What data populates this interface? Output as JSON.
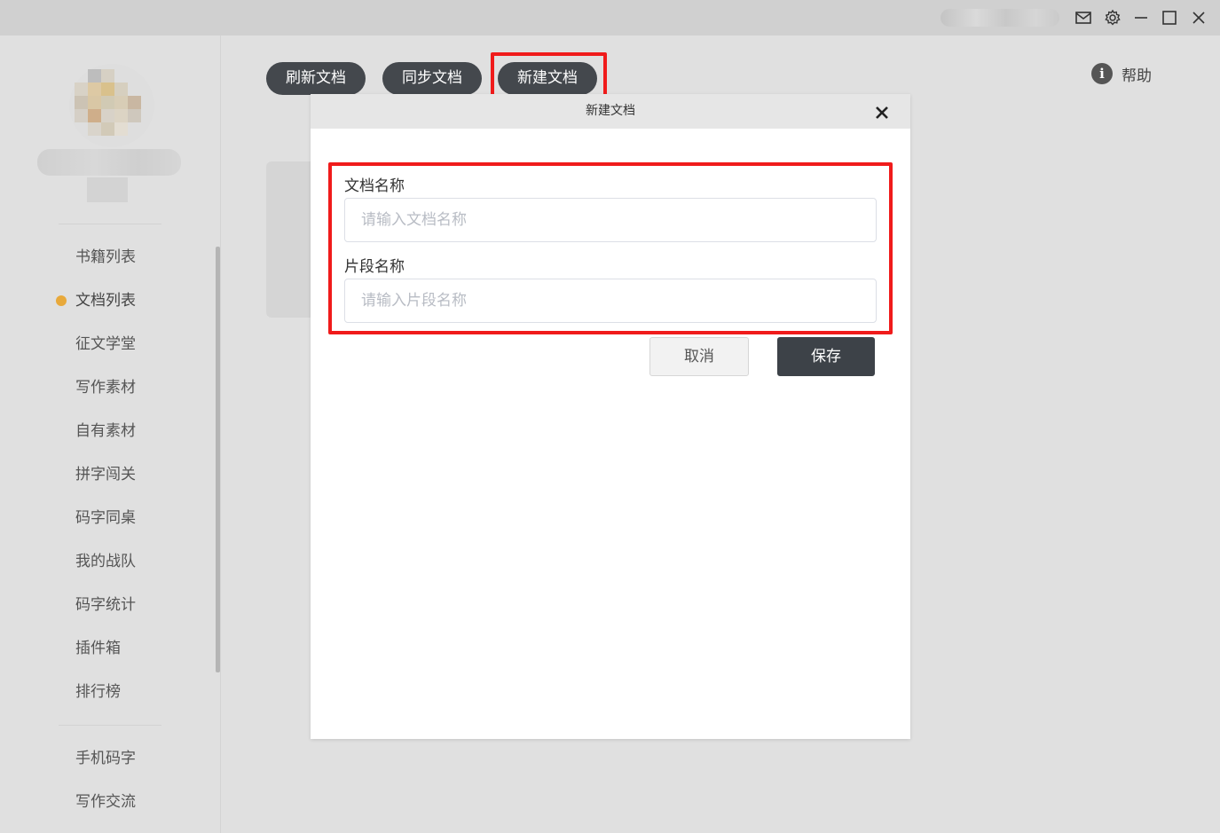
{
  "titlebar": {
    "icons": [
      "mail-icon",
      "gear-icon",
      "minimize-icon",
      "maximize-icon",
      "close-icon"
    ]
  },
  "sidebar": {
    "nav_items": [
      {
        "label": "书籍列表",
        "active": false
      },
      {
        "label": "文档列表",
        "active": true
      },
      {
        "label": "征文学堂",
        "active": false
      },
      {
        "label": "写作素材",
        "active": false
      },
      {
        "label": "自有素材",
        "active": false
      },
      {
        "label": "拼字闯关",
        "active": false
      },
      {
        "label": "码字同桌",
        "active": false
      },
      {
        "label": "我的战队",
        "active": false
      },
      {
        "label": "码字统计",
        "active": false
      },
      {
        "label": "插件箱",
        "active": false
      },
      {
        "label": "排行榜",
        "active": false
      }
    ],
    "bottom_items": [
      {
        "label": "手机码字"
      },
      {
        "label": "写作交流"
      }
    ],
    "active_dot_color": "#e8a93b"
  },
  "toolbar": {
    "refresh_label": "刷新文档",
    "sync_label": "同步文档",
    "new_label": "新建文档",
    "help_label": "帮助"
  },
  "dialog": {
    "title": "新建文档",
    "doc_name_label": "文档名称",
    "doc_name_placeholder": "请输入文档名称",
    "doc_name_value": "",
    "section_name_label": "片段名称",
    "section_name_placeholder": "请输入片段名称",
    "section_name_value": "",
    "cancel_label": "取消",
    "save_label": "保存"
  },
  "colors": {
    "highlight": "#f01b1b",
    "button_dark": "#44484d",
    "accent_dot": "#e8a93b"
  }
}
